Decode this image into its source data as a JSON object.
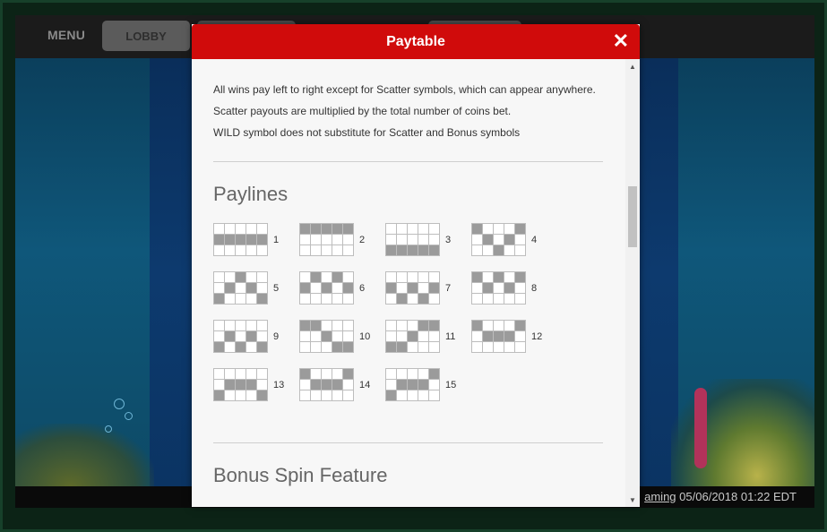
{
  "topbar": {
    "menu_label": "MENU",
    "lobby_label": "LOBBY"
  },
  "statusbar": {
    "link_text": "aming",
    "datetime": "05/06/2018 01:22 EDT"
  },
  "modal": {
    "title": "Paytable",
    "close_symbol": "✕",
    "rules": [
      "All wins pay left to right except for Scatter symbols, which can appear anywhere.",
      "Scatter payouts are multiplied by the total number of coins bet.",
      "WILD symbol does not substitute for Scatter and Bonus symbols"
    ],
    "paylines_title": "Paylines",
    "bonus_title": "Bonus Spin Feature",
    "paylines": [
      {
        "number": "1",
        "rows": [
          1,
          1,
          1,
          1,
          1
        ]
      },
      {
        "number": "2",
        "rows": [
          0,
          0,
          0,
          0,
          0
        ]
      },
      {
        "number": "3",
        "rows": [
          2,
          2,
          2,
          2,
          2
        ]
      },
      {
        "number": "4",
        "rows": [
          0,
          1,
          2,
          1,
          0
        ]
      },
      {
        "number": "5",
        "rows": [
          2,
          1,
          0,
          1,
          2
        ]
      },
      {
        "number": "6",
        "rows": [
          1,
          0,
          1,
          0,
          1
        ]
      },
      {
        "number": "7",
        "rows": [
          1,
          2,
          1,
          2,
          1
        ]
      },
      {
        "number": "8",
        "rows": [
          0,
          1,
          0,
          1,
          0
        ]
      },
      {
        "number": "9",
        "rows": [
          2,
          1,
          2,
          1,
          2
        ]
      },
      {
        "number": "10",
        "rows": [
          0,
          0,
          1,
          2,
          2
        ]
      },
      {
        "number": "11",
        "rows": [
          2,
          2,
          1,
          0,
          0
        ]
      },
      {
        "number": "12",
        "rows": [
          0,
          1,
          1,
          1,
          0
        ]
      },
      {
        "number": "13",
        "rows": [
          2,
          1,
          1,
          1,
          2
        ]
      },
      {
        "number": "14",
        "rows": [
          0,
          1,
          1,
          1,
          0
        ]
      },
      {
        "number": "15",
        "rows": [
          2,
          1,
          1,
          1,
          0
        ]
      }
    ]
  },
  "icons": {
    "scroll_up": "▲",
    "scroll_down": "▼"
  }
}
